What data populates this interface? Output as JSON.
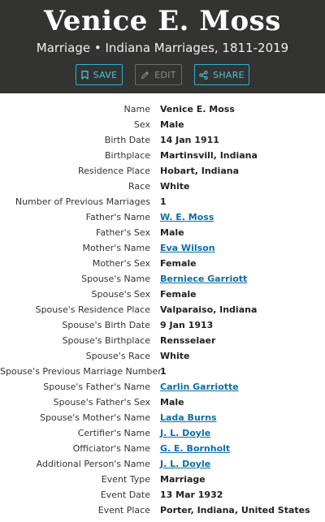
{
  "header": {
    "title": "Venice E. Moss",
    "subtitle": "Marriage • Indiana Marriages, 1811-2019",
    "actions": {
      "save_label": "SAVE",
      "edit_label": "EDIT",
      "share_label": "SHARE"
    }
  },
  "accent_color": "#36b0c9",
  "link_color": "#0d6ea8",
  "records": [
    {
      "label": "Name",
      "value": "Venice E. Moss",
      "link": false
    },
    {
      "label": "Sex",
      "value": "Male",
      "link": false
    },
    {
      "label": "Birth Date",
      "value": "14 Jan 1911",
      "link": false
    },
    {
      "label": "Birthplace",
      "value": "Martinsvill, Indiana",
      "link": false
    },
    {
      "label": "Residence Place",
      "value": "Hobart, Indiana",
      "link": false
    },
    {
      "label": "Race",
      "value": "White",
      "link": false
    },
    {
      "label": "Number of Previous Marriages",
      "value": "1",
      "link": false
    },
    {
      "label": "Father's Name",
      "value": "W. E. Moss",
      "link": true
    },
    {
      "label": "Father's Sex",
      "value": "Male",
      "link": false
    },
    {
      "label": "Mother's Name",
      "value": "Eva Wilson",
      "link": true
    },
    {
      "label": "Mother's Sex",
      "value": "Female",
      "link": false
    },
    {
      "label": "Spouse's Name",
      "value": "Berniece Garriott",
      "link": true
    },
    {
      "label": "Spouse's Sex",
      "value": "Female",
      "link": false
    },
    {
      "label": "Spouse's Residence Place",
      "value": "Valparaiso, Indiana",
      "link": false
    },
    {
      "label": "Spouse's Birth Date",
      "value": "9 Jan 1913",
      "link": false
    },
    {
      "label": "Spouse's Birthplace",
      "value": "Rensselaer",
      "link": false
    },
    {
      "label": "Spouse's Race",
      "value": "White",
      "link": false
    },
    {
      "label": "Spouse's Previous Marriage Number",
      "value": "1",
      "link": false
    },
    {
      "label": "Spouse's Father's Name",
      "value": "Carlin Garriotte",
      "link": true
    },
    {
      "label": "Spouse's Father's Sex",
      "value": "Male",
      "link": false
    },
    {
      "label": "Spouse's Mother's Name",
      "value": "Lada Burns",
      "link": true
    },
    {
      "label": "Certifier's Name",
      "value": "J. L. Doyle",
      "link": true
    },
    {
      "label": "Officiator's Name",
      "value": "G. E. Bornholt",
      "link": true
    },
    {
      "label": "Additional Person's Name",
      "value": "J. L. Doyle",
      "link": true
    },
    {
      "label": "Event Type",
      "value": "Marriage",
      "link": false
    },
    {
      "label": "Event Date",
      "value": "13 Mar 1932",
      "link": false
    },
    {
      "label": "Event Place",
      "value": "Porter, Indiana, United States",
      "link": false
    }
  ]
}
